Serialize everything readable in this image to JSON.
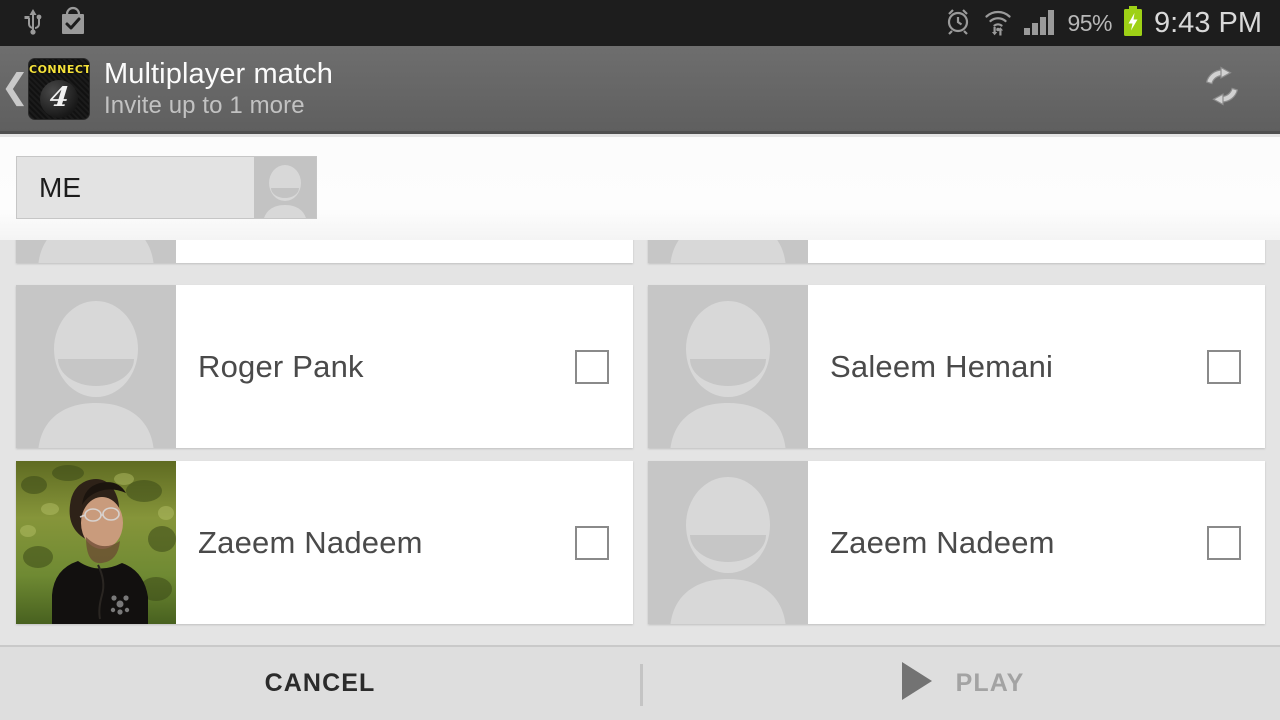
{
  "statusbar": {
    "left_icons": [
      "usb-icon",
      "shopping-bag-check-icon"
    ],
    "right_icons": [
      "alarm-icon",
      "wifi-icon",
      "signal-icon",
      "battery-charging-icon"
    ],
    "battery_percent": "95%",
    "clock": "9:43 PM"
  },
  "actionbar": {
    "back_icon": "back-chevron-icon",
    "app_icon": {
      "name": "connect-four-app-icon",
      "word": "CONNECT",
      "glyph": "4"
    },
    "title": "Multiplayer match",
    "subtitle": "Invite up to 1 more",
    "refresh_icon": "refresh-icon"
  },
  "me_chip": {
    "label": "ME",
    "avatar": "default-person-avatar"
  },
  "players": [
    {
      "name": "",
      "avatar": "default-person-avatar",
      "checked": false,
      "partial": true,
      "column": "left"
    },
    {
      "name": "",
      "avatar": "default-person-avatar",
      "checked": false,
      "partial": true,
      "column": "right"
    },
    {
      "name": "Roger Pank",
      "avatar": "default-person-avatar",
      "checked": false,
      "partial": false,
      "column": "left"
    },
    {
      "name": "Saleem Hemani",
      "avatar": "default-person-avatar",
      "checked": false,
      "partial": false,
      "column": "right"
    },
    {
      "name": "Zaeem Nadeem",
      "avatar": "photo-portrait",
      "checked": false,
      "partial": false,
      "column": "left"
    },
    {
      "name": "Zaeem Nadeem",
      "avatar": "default-person-avatar",
      "checked": false,
      "partial": false,
      "column": "right"
    }
  ],
  "bottombar": {
    "cancel_label": "CANCEL",
    "play_label": "PLAY",
    "play_icon": "play-triangle-icon",
    "play_enabled": false
  },
  "colors": {
    "statusbar_bg": "#1d1d1d",
    "actionbar_bg": "#666666",
    "list_bg": "#e4e4e4",
    "card_bg": "#ffffff",
    "avatar_bg": "#c6c6c6",
    "battery_green": "#9ed116",
    "bottombar_bg": "#dedede"
  }
}
